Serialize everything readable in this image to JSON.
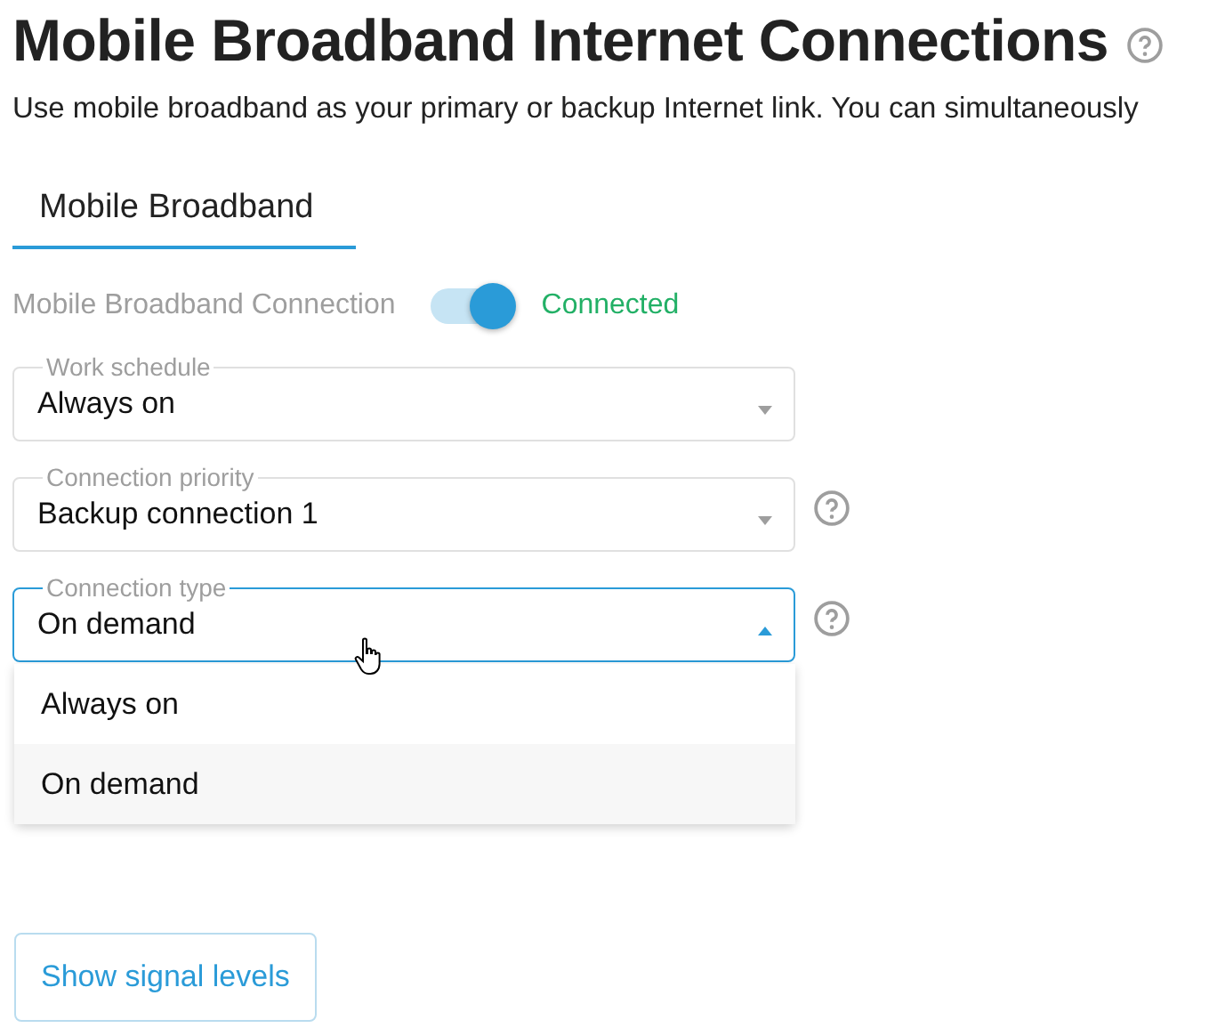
{
  "title": "Mobile Broadband Internet Connections",
  "subtitle": "Use mobile broadband as your primary or backup Internet link. You can simultaneously",
  "tabs": [
    {
      "label": "Mobile Broadband",
      "selected": true
    }
  ],
  "connection": {
    "label": "Mobile Broadband Connection",
    "on": true,
    "status": "Connected"
  },
  "fields": [
    {
      "label": "Work schedule",
      "value": "Always on",
      "help": false,
      "expanded": false
    },
    {
      "label": "Connection priority",
      "value": "Backup connection 1",
      "help": true,
      "expanded": false
    },
    {
      "label": "Connection type",
      "value": "On demand",
      "help": true,
      "expanded": true,
      "options": [
        {
          "label": "Always on",
          "selected": false
        },
        {
          "label": "On demand",
          "selected": true
        }
      ]
    }
  ],
  "button": "Show signal levels"
}
